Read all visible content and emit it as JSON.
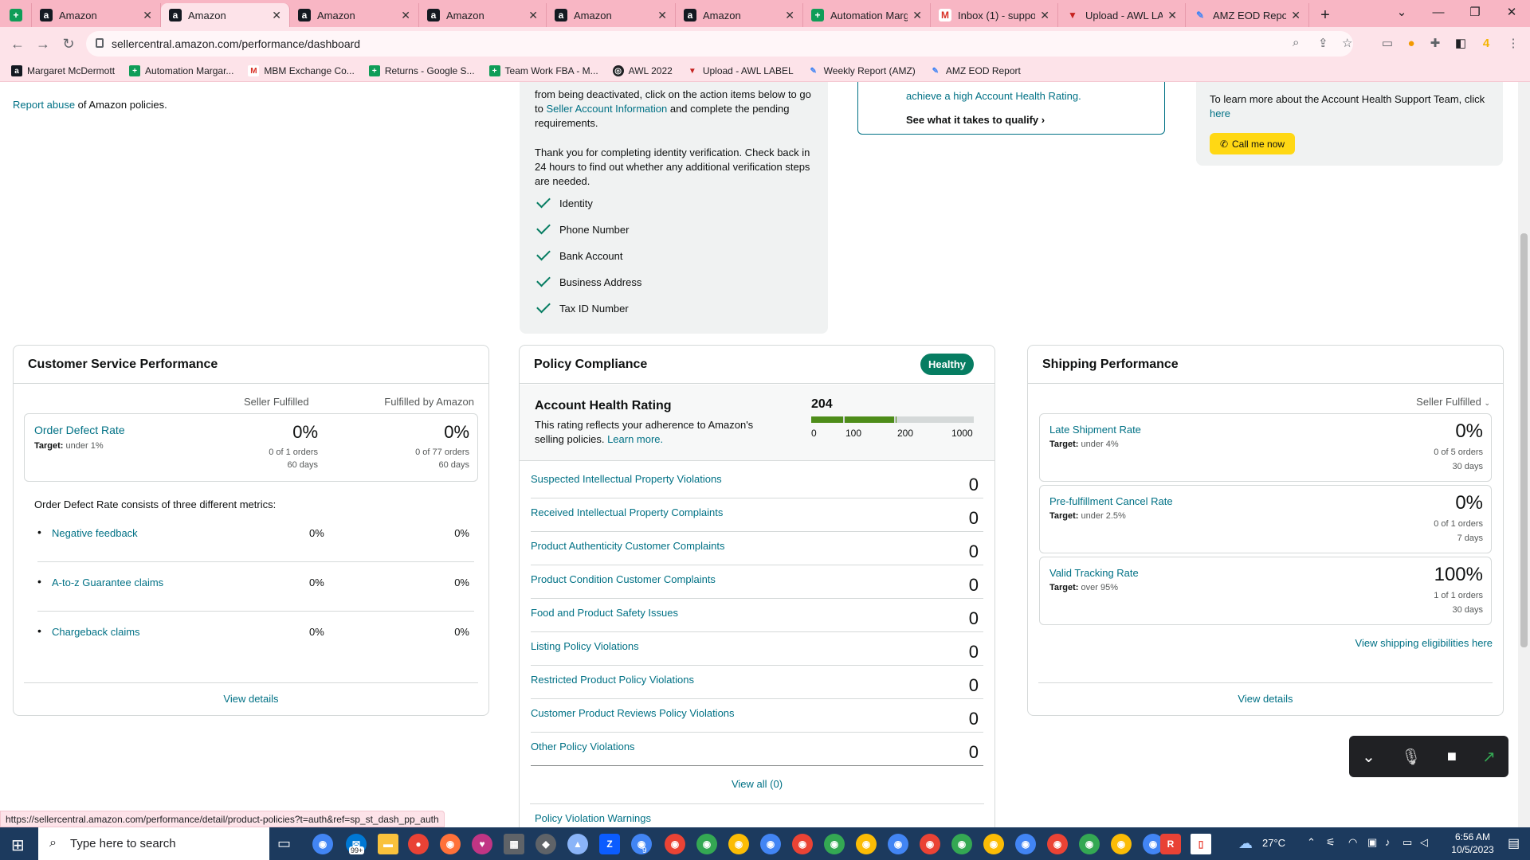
{
  "browser": {
    "tabs": [
      {
        "title": "",
        "icon": "sheets-icon",
        "kind": "sheet"
      },
      {
        "title": "Amazon",
        "icon": "amazon-icon",
        "kind": "amz"
      },
      {
        "title": "Amazon",
        "icon": "amazon-icon",
        "kind": "amz",
        "active": true
      },
      {
        "title": "Amazon",
        "icon": "amazon-icon",
        "kind": "amz"
      },
      {
        "title": "Amazon",
        "icon": "amazon-icon",
        "kind": "amz"
      },
      {
        "title": "Amazon",
        "icon": "amazon-icon",
        "kind": "amz"
      },
      {
        "title": "Amazon",
        "icon": "amazon-icon",
        "kind": "amz"
      },
      {
        "title": "Automation Marg",
        "icon": "sheets-icon",
        "kind": "sheet"
      },
      {
        "title": "Inbox (1) - suppo",
        "icon": "gmail-icon",
        "kind": "gmail"
      },
      {
        "title": "Upload - AWL LA",
        "icon": "upload-icon",
        "kind": "upl"
      },
      {
        "title": "AMZ EOD Report",
        "icon": "eod-icon",
        "kind": "eod"
      }
    ],
    "url": "sellercentral.amazon.com/performance/dashboard",
    "bookmarks": [
      {
        "label": "Margaret McDermott",
        "kind": "amz",
        "glyph": "a"
      },
      {
        "label": "Automation Margar...",
        "kind": "sheet",
        "glyph": "+"
      },
      {
        "label": "MBM Exchange Co...",
        "kind": "gmail",
        "glyph": "M"
      },
      {
        "label": "Returns - Google S...",
        "kind": "sheet",
        "glyph": "+"
      },
      {
        "label": "Team Work FBA - M...",
        "kind": "sheet",
        "glyph": "+"
      },
      {
        "label": "AWL 2022",
        "kind": "awl",
        "glyph": "◎"
      },
      {
        "label": "Upload - AWL LABEL",
        "kind": "upl",
        "glyph": "▼"
      },
      {
        "label": "Weekly Report (AMZ)",
        "kind": "eod",
        "glyph": "✎"
      },
      {
        "label": "AMZ EOD Report",
        "kind": "eod",
        "glyph": "✎"
      }
    ],
    "status_url": "https://sellercentral.amazon.com/performance/detail/product-policies?t=auth&ref=sp_st_dash_pp_auth"
  },
  "top": {
    "report_abuse_link": "Report abuse",
    "report_abuse_rest": " of Amazon policies.",
    "verify_text_1": "from being deactivated, click on the action items below to go to",
    "seller_account_link": "Seller Account Information",
    "verify_text_2": "and complete the pending requirements.",
    "verify_text_3": "Thank you for completing identity verification. Check back in 24 hours to find out whether any additional verification steps are needed.",
    "checklist": [
      "Identity",
      "Phone Number",
      "Bank Account",
      "Business Address",
      "Tax ID Number"
    ],
    "ahr_text": "achieve a high Account Health Rating.",
    "qualify_link": "See what it takes to qualify",
    "support_text": "To learn more about the Account Health Support Team, click",
    "support_link": "here",
    "call_button": "Call me now"
  },
  "customer_service": {
    "title": "Customer Service Performance",
    "col_seller": "Seller Fulfilled",
    "col_amazon": "Fulfilled by Amazon",
    "odr_label": "Order Defect Rate",
    "odr_target_label": "Target:",
    "odr_target": "under 1%",
    "seller_value": "0%",
    "seller_orders": "0 of 1 orders",
    "seller_days": "60 days",
    "amazon_value": "0%",
    "amazon_orders": "0 of 77 orders",
    "amazon_days": "60 days",
    "consists_text": "Order Defect Rate consists of three different metrics:",
    "metrics": [
      {
        "label": "Negative feedback",
        "seller": "0%",
        "amazon": "0%"
      },
      {
        "label": "A-to-z Guarantee claims",
        "seller": "0%",
        "amazon": "0%"
      },
      {
        "label": "Chargeback claims",
        "seller": "0%",
        "amazon": "0%"
      }
    ],
    "view_details": "View details"
  },
  "policy": {
    "title": "Policy Compliance",
    "badge": "Healthy",
    "ahr_title": "Account Health Rating",
    "ahr_desc": "This rating reflects your adherence to Amazon's selling policies.",
    "learn_more": "Learn more.",
    "score": "204",
    "score_value": 204,
    "scale": [
      "0",
      "100",
      "200",
      "1000"
    ],
    "rows": [
      {
        "label": "Suspected Intellectual Property Violations",
        "count": "0"
      },
      {
        "label": "Received Intellectual Property Complaints",
        "count": "0"
      },
      {
        "label": "Product Authenticity Customer Complaints",
        "count": "0"
      },
      {
        "label": "Product Condition Customer Complaints",
        "count": "0"
      },
      {
        "label": "Food and Product Safety Issues",
        "count": "0"
      },
      {
        "label": "Listing Policy Violations",
        "count": "0"
      },
      {
        "label": "Restricted Product Policy Violations",
        "count": "0"
      },
      {
        "label": "Customer Product Reviews Policy Violations",
        "count": "0"
      },
      {
        "label": "Other Policy Violations",
        "count": "0"
      }
    ],
    "view_all": "View all (0)",
    "next_section_partial": "Policy Violation Warnings"
  },
  "shipping": {
    "title": "Shipping Performance",
    "dropdown": "Seller Fulfilled",
    "boxes": [
      {
        "label": "Late Shipment Rate",
        "target_label": "Target:",
        "target": "under 4%",
        "value": "0%",
        "orders": "0 of 5 orders",
        "days": "30 days"
      },
      {
        "label": "Pre-fulfillment Cancel Rate",
        "target_label": "Target:",
        "target": "under 2.5%",
        "value": "0%",
        "orders": "0 of 1 orders",
        "days": "7 days"
      },
      {
        "label": "Valid Tracking Rate",
        "target_label": "Target:",
        "target": "over 95%",
        "value": "100%",
        "orders": "1 of 1 orders",
        "days": "30 days"
      }
    ],
    "eligibilities_link": "View shipping eligibilities here",
    "view_details": "View details"
  },
  "taskbar": {
    "search_placeholder": "Type here to search",
    "weather": "27°C",
    "time": "6:56 AM",
    "date": "10/5/2023",
    "mail_badge": "99+",
    "chrome_badge": "9"
  },
  "colors": {
    "link": "#007185",
    "healthy_badge": "#067d62",
    "call_button": "#ffd814",
    "rating_bar": "#4e8d1a"
  }
}
